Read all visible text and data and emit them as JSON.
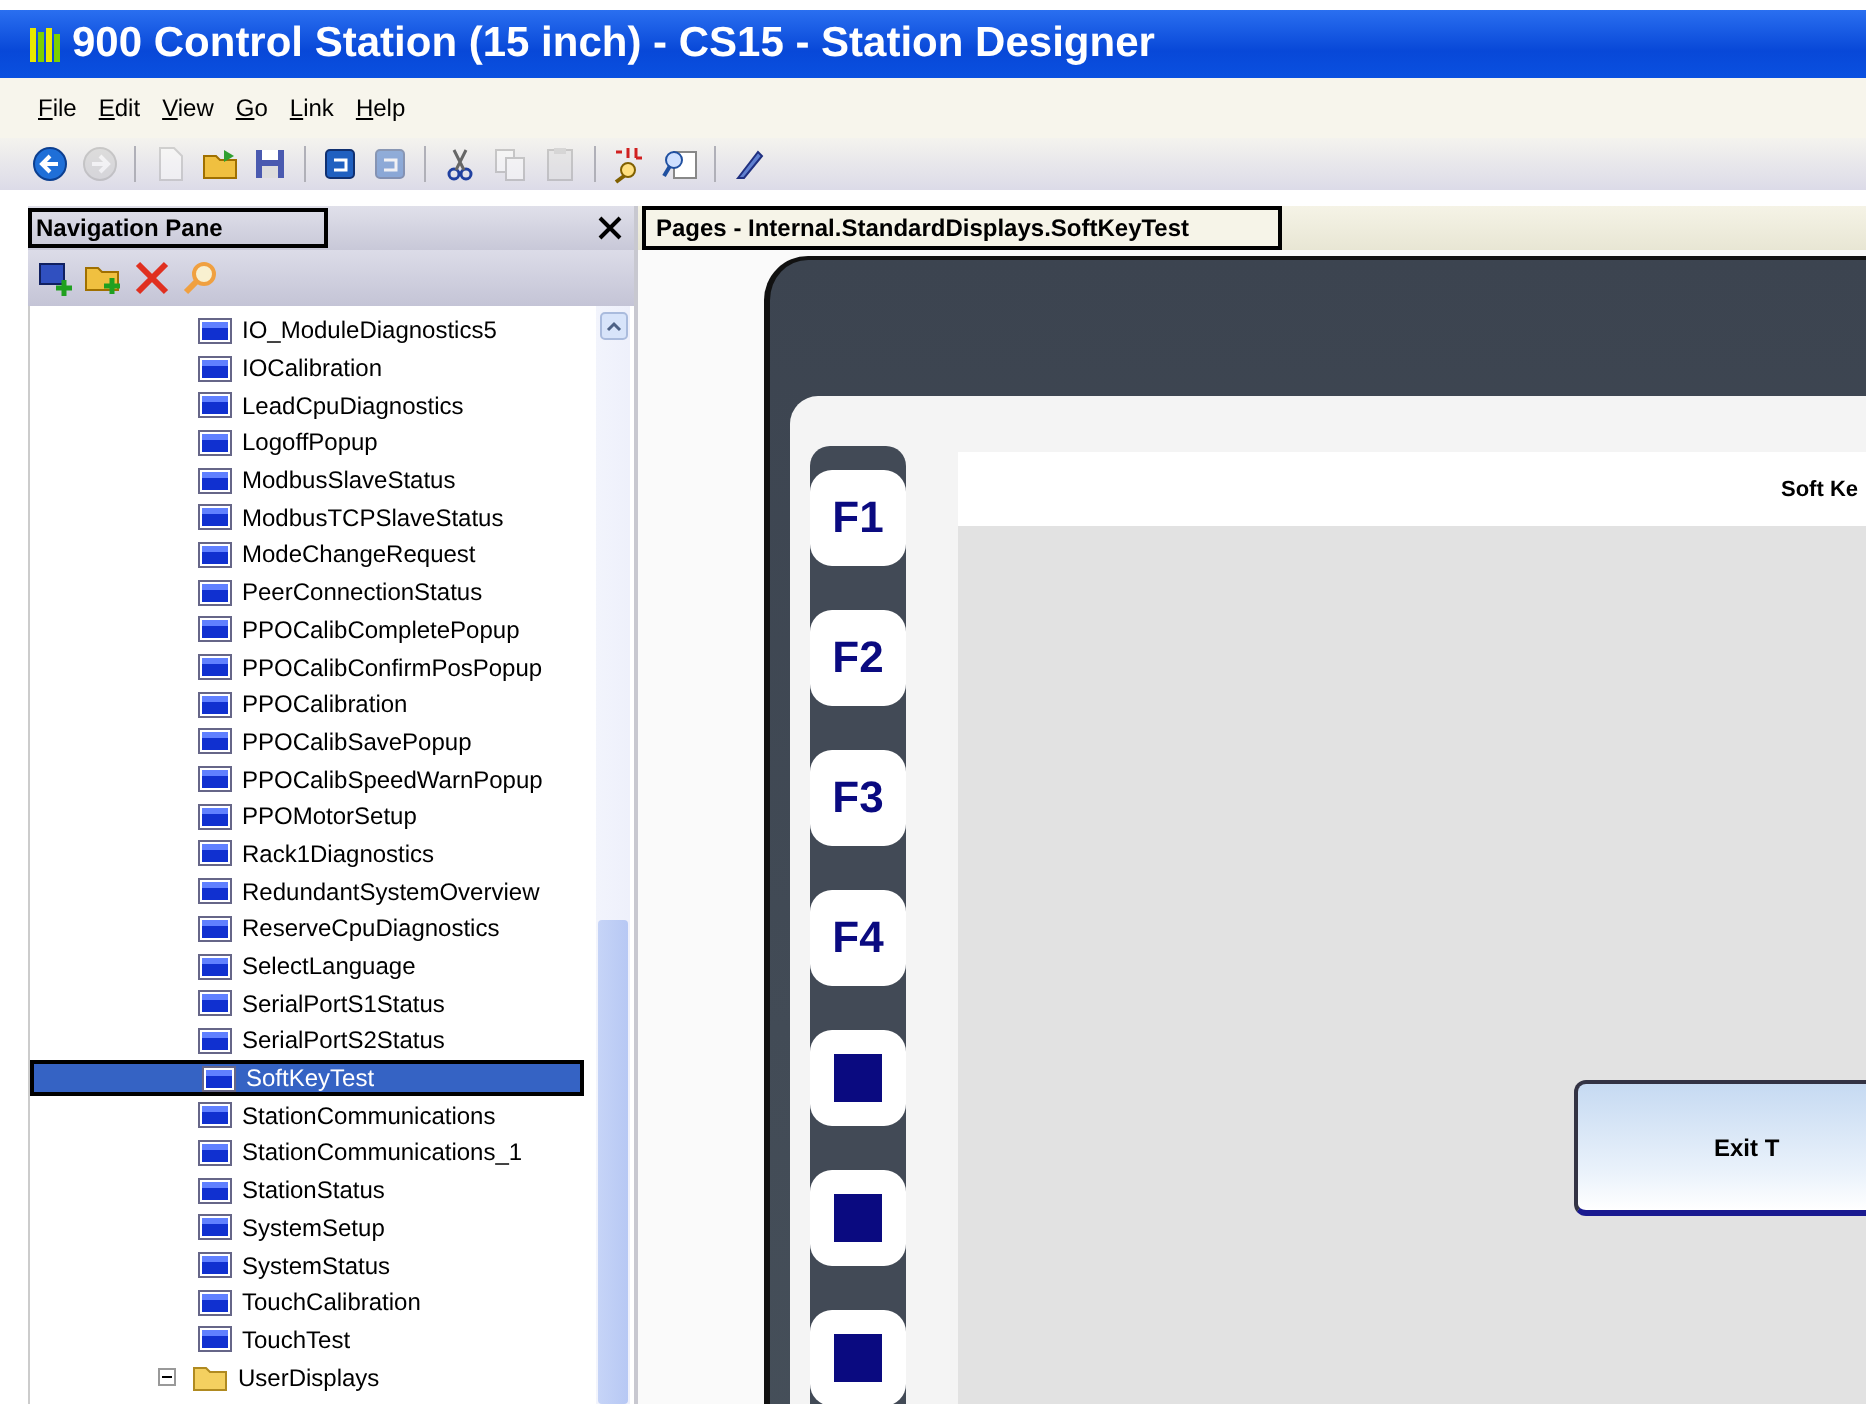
{
  "window": {
    "title": "900 Control Station (15 inch) - CS15 - Station Designer"
  },
  "menu": [
    "File",
    "Edit",
    "View",
    "Go",
    "Link",
    "Help"
  ],
  "toolbar": [
    {
      "kind": "back",
      "disabled": false
    },
    {
      "kind": "forward",
      "disabled": true
    },
    {
      "kind": "sep"
    },
    {
      "kind": "new",
      "disabled": true
    },
    {
      "kind": "open",
      "disabled": false
    },
    {
      "kind": "save",
      "disabled": false
    },
    {
      "kind": "sep"
    },
    {
      "kind": "blue",
      "disabled": false
    },
    {
      "kind": "blue",
      "disabled": true
    },
    {
      "kind": "sep"
    },
    {
      "kind": "cut",
      "disabled": false
    },
    {
      "kind": "copy",
      "disabled": true
    },
    {
      "kind": "paste",
      "disabled": true
    },
    {
      "kind": "sep"
    },
    {
      "kind": "findall",
      "disabled": false
    },
    {
      "kind": "find",
      "disabled": false
    },
    {
      "kind": "sep"
    },
    {
      "kind": "pen",
      "disabled": false
    }
  ],
  "navigation_pane": {
    "title": "Navigation Pane",
    "toolbar": [
      {
        "kind": "addpage"
      },
      {
        "kind": "addfolder"
      },
      {
        "kind": "delete"
      },
      {
        "kind": "search"
      }
    ],
    "tree": [
      {
        "kind": "group",
        "children": [
          {
            "kind": "page",
            "label": "IO_ModuleDiagnostics5",
            "selected": false
          },
          {
            "kind": "page",
            "label": "IOCalibration",
            "selected": false
          },
          {
            "kind": "page",
            "label": "LeadCpuDiagnostics",
            "selected": false
          },
          {
            "kind": "page",
            "label": "LogoffPopup",
            "selected": false
          },
          {
            "kind": "page",
            "label": "ModbusSlaveStatus",
            "selected": false
          },
          {
            "kind": "page",
            "label": "ModbusTCPSlaveStatus",
            "selected": false
          },
          {
            "kind": "page",
            "label": "ModeChangeRequest",
            "selected": false
          },
          {
            "kind": "page",
            "label": "PeerConnectionStatus",
            "selected": false
          },
          {
            "kind": "page",
            "label": "PPOCalibCompletePopup",
            "selected": false
          },
          {
            "kind": "page",
            "label": "PPOCalibConfirmPosPopup",
            "selected": false
          },
          {
            "kind": "page",
            "label": "PPOCalibration",
            "selected": false
          },
          {
            "kind": "page",
            "label": "PPOCalibSavePopup",
            "selected": false
          },
          {
            "kind": "page",
            "label": "PPOCalibSpeedWarnPopup",
            "selected": false
          },
          {
            "kind": "page",
            "label": "PPOMotorSetup",
            "selected": false
          },
          {
            "kind": "page",
            "label": "Rack1Diagnostics",
            "selected": false
          },
          {
            "kind": "page",
            "label": "RedundantSystemOverview",
            "selected": false
          },
          {
            "kind": "page",
            "label": "ReserveCpuDiagnostics",
            "selected": false
          },
          {
            "kind": "page",
            "label": "SelectLanguage",
            "selected": false
          },
          {
            "kind": "page",
            "label": "SerialPortS1Status",
            "selected": false
          },
          {
            "kind": "page",
            "label": "SerialPortS2Status",
            "selected": false
          },
          {
            "kind": "page",
            "label": "SoftKeyTest",
            "selected": true
          },
          {
            "kind": "page",
            "label": "StationCommunications",
            "selected": false
          },
          {
            "kind": "page",
            "label": "StationCommunications_1",
            "selected": false
          },
          {
            "kind": "page",
            "label": "StationStatus",
            "selected": false
          },
          {
            "kind": "page",
            "label": "SystemSetup",
            "selected": false
          },
          {
            "kind": "page",
            "label": "SystemStatus",
            "selected": false
          },
          {
            "kind": "page",
            "label": "TouchCalibration",
            "selected": false
          },
          {
            "kind": "page",
            "label": "TouchTest",
            "selected": false
          }
        ]
      },
      {
        "kind": "folder",
        "label": "UserDisplays",
        "expanded": true,
        "selected": false
      }
    ]
  },
  "document": {
    "tab": "Pages - Internal.StandardDisplays.SoftKeyTest",
    "soft_keys": [
      {
        "kind": "label",
        "label": "F1"
      },
      {
        "kind": "label",
        "label": "F2"
      },
      {
        "kind": "label",
        "label": "F3"
      },
      {
        "kind": "label",
        "label": "F4"
      },
      {
        "kind": "blank"
      },
      {
        "kind": "blank"
      },
      {
        "kind": "blank"
      }
    ],
    "screen_title": "Soft Ke",
    "exit_button": "Exit T"
  }
}
